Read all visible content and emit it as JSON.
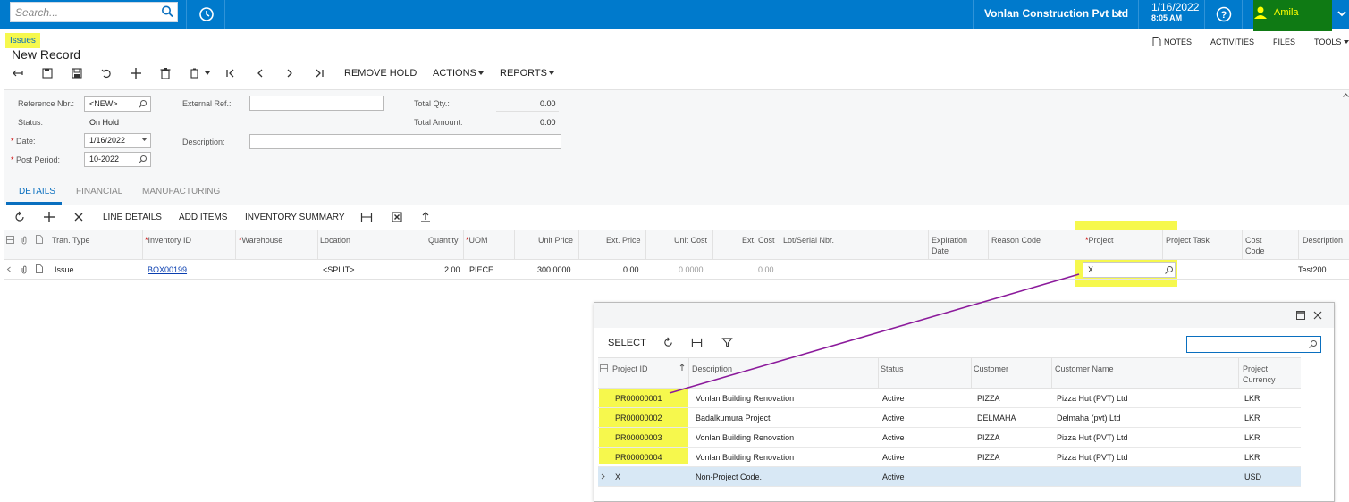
{
  "topbar": {
    "search_placeholder": "Search...",
    "company": "Vonlan Construction Pvt Ltd",
    "date": "1/16/2022",
    "time": "8:05 AM",
    "user": "Amila"
  },
  "header": {
    "breadcrumb": "Issues",
    "title": "New Record",
    "links": [
      "NOTES",
      "ACTIVITIES",
      "FILES",
      "TOOLS"
    ]
  },
  "toolbar": {
    "remove_hold": "REMOVE HOLD",
    "actions": "ACTIONS",
    "reports": "REPORTS"
  },
  "form": {
    "reference_nbr_label": "Reference Nbr.:",
    "reference_nbr": "<NEW>",
    "status_label": "Status:",
    "status": "On Hold",
    "date_label": "Date:",
    "date": "1/16/2022",
    "post_period_label": "Post Period:",
    "post_period": "10-2022",
    "external_ref_label": "External Ref.:",
    "external_ref": "",
    "description_label": "Description:",
    "description": "",
    "total_qty_label": "Total Qty.:",
    "total_qty": "0.00",
    "total_amount_label": "Total Amount:",
    "total_amount": "0.00"
  },
  "tabs": [
    "DETAILS",
    "FINANCIAL",
    "MANUFACTURING"
  ],
  "grid_toolbar": {
    "line_details": "LINE DETAILS",
    "add_items": "ADD ITEMS",
    "inventory_summary": "INVENTORY SUMMARY"
  },
  "grid": {
    "columns": {
      "tran_type": "Tran. Type",
      "inventory_id": "Inventory ID",
      "warehouse": "Warehouse",
      "location": "Location",
      "quantity": "Quantity",
      "uom": "UOM",
      "unit_price": "Unit Price",
      "ext_price": "Ext. Price",
      "unit_cost": "Unit Cost",
      "ext_cost": "Ext. Cost",
      "lot_serial": "Lot/Serial Nbr.",
      "expiration_1": "Expiration",
      "expiration_2": "Date",
      "reason_code": "Reason Code",
      "project": "Project",
      "project_task": "Project Task",
      "cost_code_1": "Cost",
      "cost_code_2": "Code",
      "description": "Description"
    },
    "row": {
      "tran_type": "Issue",
      "inventory_id": "BOX00199",
      "location": "<SPLIT>",
      "quantity": "2.00",
      "uom": "PIECE",
      "unit_price": "300.0000",
      "ext_price": "0.00",
      "unit_cost": "0.0000",
      "ext_cost": "0.00",
      "project": "X",
      "description": "Test200"
    }
  },
  "popup": {
    "select": "SELECT",
    "columns": {
      "project_id": "Project ID",
      "description": "Description",
      "status": "Status",
      "customer": "Customer",
      "customer_name": "Customer Name",
      "project_currency_1": "Project",
      "project_currency_2": "Currency"
    },
    "rows": [
      {
        "id": "PR00000001",
        "description": "Vonlan Building Renovation",
        "status": "Active",
        "customer": "PIZZA",
        "customer_name": "Pizza Hut (PVT) Ltd",
        "currency": "LKR"
      },
      {
        "id": "PR00000002",
        "description": "Badalkumura Project",
        "status": "Active",
        "customer": "DELMAHA",
        "customer_name": "Delmaha (pvt) Ltd",
        "currency": "LKR"
      },
      {
        "id": "PR00000003",
        "description": "Vonlan Building Renovation",
        "status": "Active",
        "customer": "PIZZA",
        "customer_name": "Pizza Hut (PVT) Ltd",
        "currency": "LKR"
      },
      {
        "id": "PR00000004",
        "description": "Vonlan Building Renovation",
        "status": "Active",
        "customer": "PIZZA",
        "customer_name": "Pizza Hut (PVT) Ltd",
        "currency": "LKR"
      },
      {
        "id": "X",
        "description": "Non-Project Code.",
        "status": "Active",
        "customer": "",
        "customer_name": "",
        "currency": "USD"
      }
    ]
  },
  "colors": {
    "topbar": "#007acc",
    "highlight": "#f6f84d",
    "user_box": "#0f7a14",
    "annotation_arrow": "#8b1a9b"
  }
}
